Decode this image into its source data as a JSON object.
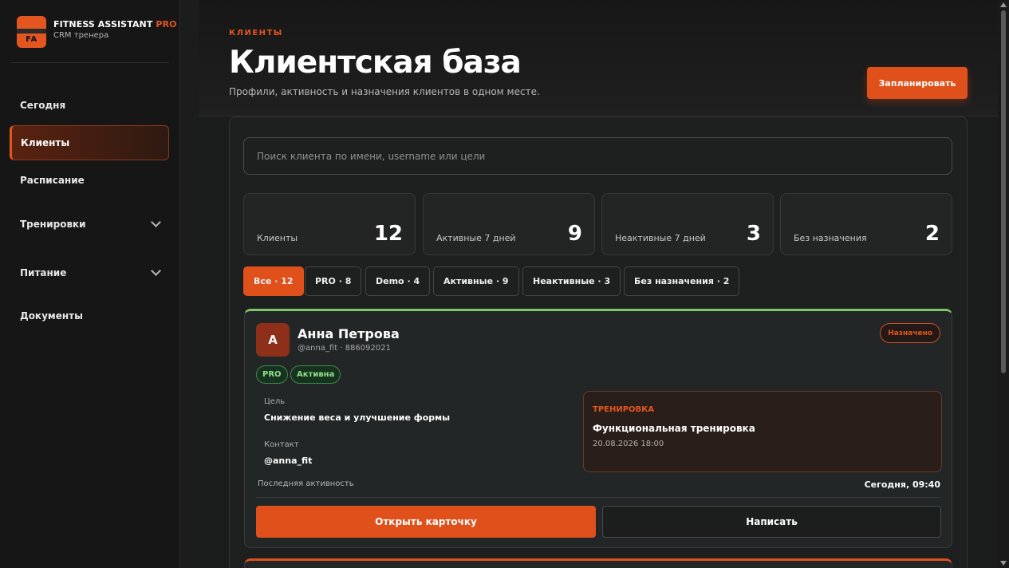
{
  "brand": {
    "logo_text": "FA",
    "title": "FITNESS ASSISTANT",
    "title_accent": "PRO",
    "subtitle": "CRM тренера"
  },
  "sidebar": {
    "items": [
      {
        "label": "Сегодня",
        "active": false
      },
      {
        "label": "Клиенты",
        "active": true
      },
      {
        "label": "Расписание",
        "active": false
      },
      {
        "label": "Тренировки",
        "active": false,
        "expandable": true
      },
      {
        "label": "Питание",
        "active": false,
        "expandable": true
      },
      {
        "label": "Документы",
        "active": false
      }
    ]
  },
  "header": {
    "eyebrow": "КЛИЕНТЫ",
    "title": "Клиентская база",
    "subtitle": "Профили, активность и назначения клиентов в одном месте.",
    "action_label": "Запланировать"
  },
  "search": {
    "placeholder": "Поиск клиента по имени, username или цели",
    "value": ""
  },
  "stats": [
    {
      "label": "Клиенты",
      "value": "12"
    },
    {
      "label": "Активные 7 дней",
      "value": "9"
    },
    {
      "label": "Неактивные 7 дней",
      "value": "3"
    },
    {
      "label": "Без назначения",
      "value": "2"
    }
  ],
  "filters": [
    {
      "label": "Все · 12",
      "active": true
    },
    {
      "label": "PRO · 8",
      "active": false
    },
    {
      "label": "Demo · 4",
      "active": false
    },
    {
      "label": "Активные · 9",
      "active": false
    },
    {
      "label": "Неактивные · 3",
      "active": false
    },
    {
      "label": "Без назначения · 2",
      "active": false
    }
  ],
  "client_card": {
    "avatar_letter": "А",
    "name": "Анна Петрова",
    "handle": "@anna_fit · 886092021",
    "status": "Назначено",
    "badges": [
      "PRO",
      "Активна"
    ],
    "goal_label": "Цель",
    "goal_value": "Снижение веса и улучшение формы",
    "contact_label": "Контакт",
    "contact_value": "@anna_fit",
    "assignment": {
      "tag": "ТРЕНИРОВКА",
      "title": "Функциональная тренировка",
      "datetime": "20.08.2026 18:00"
    },
    "last_activity_label": "Последняя активность",
    "last_activity_value": "Сегодня, 09:40",
    "open_label": "Открыть карточку",
    "message_label": "Написать"
  },
  "colors": {
    "accent": "#e0501b",
    "active_border": "#7cc56a",
    "background": "#1b1c1c"
  }
}
